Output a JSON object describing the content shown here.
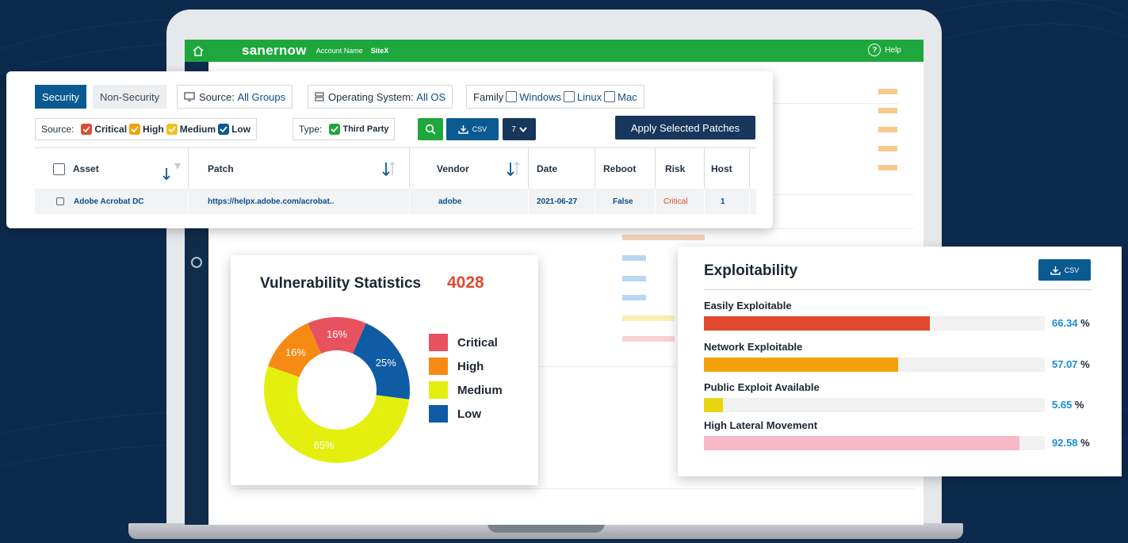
{
  "header": {
    "brand": "sanernow",
    "account_name": "Account Name",
    "site": "SiteX",
    "help": "Help"
  },
  "tabs": {
    "security": "Security",
    "non_security": "Non-Security"
  },
  "filters": {
    "source_groups_label": "Source:",
    "source_groups_value": "All Groups",
    "os_label": "Operating System:",
    "os_value": "All OS",
    "family_label": "Family",
    "family_windows": "Windows",
    "family_linux": "Linux",
    "family_mac": "Mac",
    "severity_label": "Source:",
    "critical": "Critical",
    "high": "High",
    "medium": "Medium",
    "low": "Low",
    "type_label": "Type:",
    "type_value": "Third Party",
    "csv": "CSV",
    "page_size": "7",
    "apply": "Apply Selected Patches"
  },
  "table": {
    "columns": [
      "Asset",
      "Patch",
      "Vendor",
      "Date",
      "Reboot",
      "Risk",
      "Host"
    ],
    "rows": [
      {
        "asset": "Adobe Acrobat DC",
        "patch": "https://helpx.adobe.com/acrobat..",
        "vendor": "adobe",
        "date": "2021-06-27",
        "reboot": "False",
        "risk": "Critical",
        "host": "1"
      }
    ]
  },
  "vuln_stats": {
    "title": "Vulnerability Statistics",
    "total": "4028",
    "chart_data": {
      "type": "pie",
      "categories": [
        "Critical",
        "High",
        "Medium",
        "Low"
      ],
      "values": [
        16,
        16,
        65,
        25
      ],
      "value_labels": [
        "16%",
        "16%",
        "65%",
        "25%"
      ],
      "colors": [
        "#e8525f",
        "#f78a12",
        "#e4ef10",
        "#0f5ba4"
      ],
      "legend_position": "right"
    }
  },
  "exploitability": {
    "title": "Exploitability",
    "csv": "CSV",
    "items": [
      {
        "label": "Easily Exploitable",
        "value": 66.34,
        "display": "66.34",
        "unit": "%",
        "color": "#e0492e"
      },
      {
        "label": "Network Exploitable",
        "value": 57.07,
        "display": "57.07",
        "unit": "%",
        "color": "#f5a10a"
      },
      {
        "label": "Public Exploit Available",
        "value": 5.65,
        "display": "5.65",
        "unit": "%",
        "color": "#e8d60f"
      },
      {
        "label": "High Lateral Movement",
        "value": 92.58,
        "display": "92.58",
        "unit": "%",
        "color": "#f9b8c7"
      }
    ]
  },
  "colors": {
    "accent_green": "#1ea73c",
    "primary_blue": "#0a5a91",
    "navy": "#17375c",
    "background": "#0c2a4c"
  }
}
